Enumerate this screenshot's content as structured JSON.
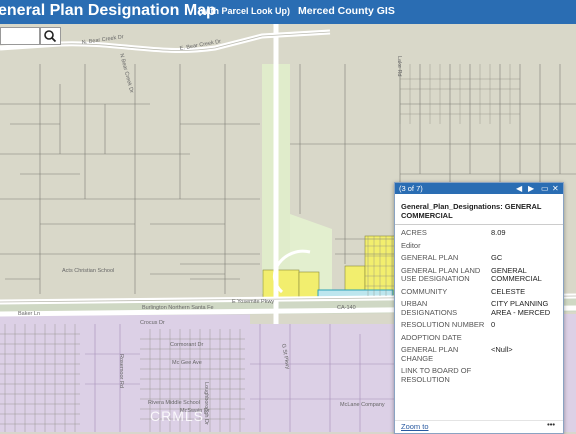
{
  "header": {
    "title": "eneral Plan Designation Map",
    "subtitle": "(with Parcel Look Up)",
    "org": "Merced County GIS"
  },
  "search": {
    "value": "",
    "placeholder": ""
  },
  "colors": {
    "header_bg": "#2a6db3",
    "general_zone": "#d9d8c9",
    "city_planning_area": "#dcd0e6",
    "commercial": "#f2ee6e",
    "highway": "#e0eccb",
    "parcel_lines": "#7d7d75"
  },
  "map_labels": {
    "road_bear_creek_1": "N. Bear Creek Dr",
    "road_bear_creek_2": "E. Bear Creek Dr",
    "road_bear_creek_3": "N Bear Creek Dr",
    "road_g": "G St",
    "road_yosemite": "E Yosemite Pkwy",
    "road_ca140": "CA-140",
    "road_burlington": "Burlington Northern Santa Fe",
    "road_baker": "Baker Ln",
    "road_lake": "Lake Rd",
    "road_cormorant": "Cormorant Dr",
    "road_loughborough": "Loughborough Dr",
    "road_mcgee": "Mc Gee Ave",
    "road_mcswain": "McSwain Dr",
    "road_rosemoor": "Rosemoor Rd",
    "road_crocus": "Crocus Dr",
    "road_parkway": "G St Pkwy",
    "poi_acts": "Acts Christian School",
    "poi_middle": "Rivera Middle School",
    "poi_mclane": "McLane Company"
  },
  "popup": {
    "count": "(3 of 7)",
    "prev_icon": "prev-arrow-icon",
    "next_icon": "next-arrow-icon",
    "maximize_icon": "maximize-icon",
    "close_icon": "close-icon",
    "title": "General_Plan_Designations: GENERAL COMMERCIAL",
    "attributes": [
      {
        "key": "ACRES",
        "value": "8.09"
      },
      {
        "key": "Editor",
        "value": ""
      },
      {
        "key": "GENERAL PLAN",
        "value": "GC"
      },
      {
        "key": "GENERAL PLAN LAND USE DESIGNATION",
        "value": "GENERAL COMMERCIAL"
      },
      {
        "key": "COMMUNITY",
        "value": "CELESTE"
      },
      {
        "key": "URBAN DESIGNATIONS",
        "value": "CITY PLANNING AREA - MERCED"
      },
      {
        "key": "RESOLUTION NUMBER",
        "value": "0"
      },
      {
        "key": "ADOPTION DATE",
        "value": ""
      },
      {
        "key": "GENERAL PLAN CHANGE",
        "value": "<Null>"
      },
      {
        "key": "LINK TO BOARD OF RESOLUTION",
        "value": ""
      }
    ],
    "zoom_label": "Zoom to",
    "more_label": "•••"
  },
  "watermark": "CRMLS"
}
